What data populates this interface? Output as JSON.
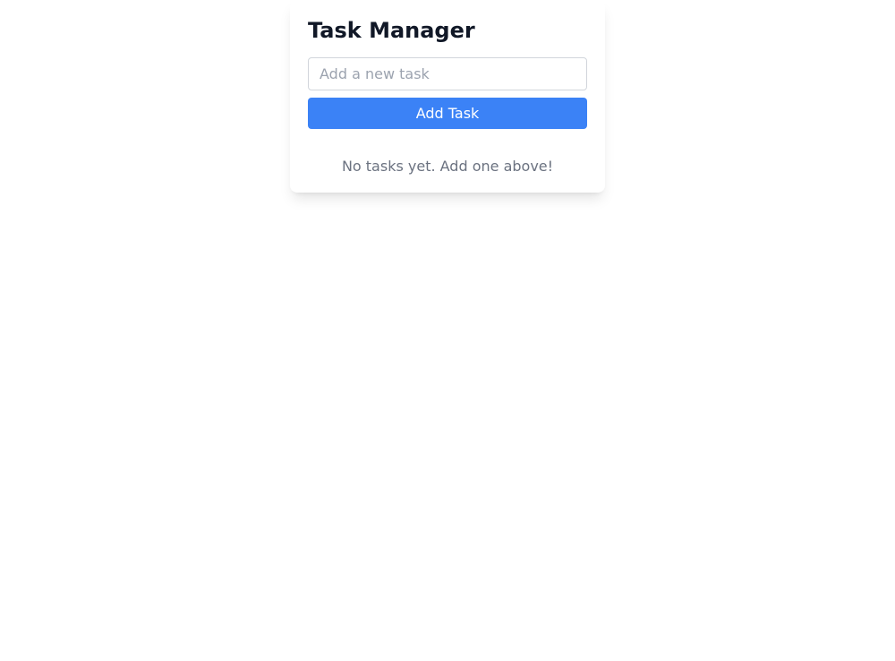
{
  "header": {
    "title": "Task Manager"
  },
  "form": {
    "input_placeholder": "Add a new task",
    "input_value": "",
    "button_label": "Add Task"
  },
  "tasks": {
    "empty_message": "No tasks yet. Add one above!"
  }
}
